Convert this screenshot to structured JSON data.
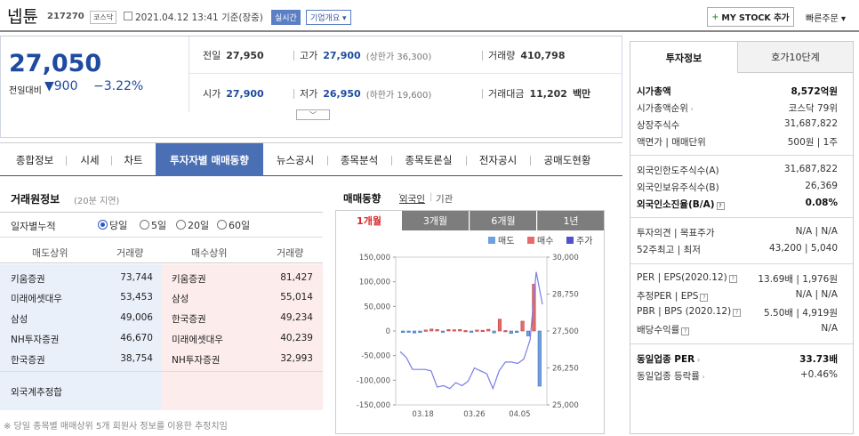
{
  "header": {
    "name": "넵튠",
    "code": "217270",
    "market": "코스닥",
    "datetime": "2021.04.12 13:41 기준(장중)",
    "live": "실시간",
    "company_btn": "기업개요 ▾",
    "mystock": "MY STOCK 추가",
    "quick_order": "빠른주문 ▾"
  },
  "price": {
    "current": "27,050",
    "change_label": "전일대비",
    "change": "▼900",
    "rate": "−3.22%"
  },
  "quote": {
    "prev_label": "전일",
    "prev": "27,950",
    "high_label": "고가",
    "high": "27,900",
    "upper": "(상한가 36,300)",
    "vol_label": "거래량",
    "vol": "410,798",
    "open_label": "시가",
    "open": "27,900",
    "low_label": "저가",
    "low": "26,950",
    "lower": "(하한가 19,600)",
    "amt_label": "거래대금",
    "amt": "11,202",
    "amt_unit": "백만"
  },
  "tabs": [
    "종합정보",
    "시세",
    "차트",
    "투자자별 매매동향",
    "뉴스공시",
    "종목분석",
    "종목토론실",
    "전자공시",
    "공매도현황"
  ],
  "broker": {
    "title": "거래원정보",
    "sub": "(20분 지연)",
    "period_label": "일자별누적",
    "options": [
      "당일",
      "5일",
      "20일",
      "60일"
    ],
    "headers": [
      "매도상위",
      "거래량",
      "매수상위",
      "거래량"
    ],
    "rows": [
      {
        "sell": "키움증권",
        "sell_vol": "73,744",
        "buy": "키움증권",
        "buy_vol": "81,427"
      },
      {
        "sell": "미래에셋대우",
        "sell_vol": "53,453",
        "buy": "삼성",
        "buy_vol": "55,014"
      },
      {
        "sell": "삼성",
        "sell_vol": "49,006",
        "buy": "한국증권",
        "buy_vol": "49,234"
      },
      {
        "sell": "NH투자증권",
        "sell_vol": "46,670",
        "buy": "미래에셋대우",
        "buy_vol": "40,239"
      },
      {
        "sell": "한국증권",
        "sell_vol": "38,754",
        "buy": "NH투자증권",
        "buy_vol": "32,993"
      }
    ],
    "foreign": "외국계추정합",
    "note": "※ 당일 종목별 매매상위 5개 회원사 정보를 이용한 추정치임"
  },
  "trade_chart": {
    "title": "매매동향",
    "foreign": "외국인",
    "inst": "기관",
    "periods": [
      "1개월",
      "3개월",
      "6개월",
      "1년"
    ]
  },
  "chart_data": {
    "type": "bar",
    "legend": [
      "매도",
      "매수",
      "주가"
    ],
    "x_ticks": [
      "03.18",
      "03.26",
      "04.05"
    ],
    "y_left_ticks": [
      "150,000",
      "100,000",
      "50,000",
      "0",
      "-50,000",
      "-100,000",
      "-150,000"
    ],
    "y_right_ticks": [
      "30,000",
      "28,750",
      "27,500",
      "26,250",
      "25,000"
    ],
    "ylim_left": [
      -150000,
      150000
    ],
    "ylim_right": [
      25000,
      30000
    ],
    "net": [
      -3000,
      -2000,
      -4000,
      -3000,
      2000,
      4000,
      3000,
      -2000,
      3000,
      2500,
      3000,
      1000,
      -1000,
      2000,
      1500,
      3500,
      -4000,
      24000,
      1000,
      -5000,
      -3000,
      20000,
      -10000,
      95000,
      -112000
    ],
    "price": [
      26800,
      26600,
      26200,
      26200,
      26200,
      26150,
      25600,
      25650,
      25550,
      25750,
      25650,
      25800,
      26250,
      26150,
      26050,
      25550,
      26150,
      26450,
      26450,
      26400,
      26550,
      27200,
      29500,
      28400
    ]
  },
  "invest": {
    "tabs": [
      "투자정보",
      "호가10단계"
    ],
    "rows": [
      {
        "label": "시가총액",
        "value": "8,572억원"
      },
      {
        "label": "시가총액순위",
        "value": "코스닥 79위"
      },
      {
        "label": "상장주식수",
        "value": "31,687,822"
      },
      {
        "label": "액면가 | 매매단위",
        "value": "500원 | 1주"
      },
      {
        "label": "외국인한도주식수(A)",
        "value": "31,687,822"
      },
      {
        "label": "외국인보유주식수(B)",
        "value": "26,369"
      },
      {
        "label": "외국인소진율(B/A)",
        "value": "0.08%"
      },
      {
        "label": "투자의견 | 목표주가",
        "value": "N/A | N/A"
      },
      {
        "label": "52주최고 | 최저",
        "value": "43,200 | 5,040"
      },
      {
        "label": "PER | EPS(2020.12)",
        "value": "13.69배 | 1,976원"
      },
      {
        "label": "추정PER | EPS",
        "value": "N/A | N/A"
      },
      {
        "label": "PBR | BPS (2020.12)",
        "value": "5.50배 | 4,919원"
      },
      {
        "label": "배당수익률",
        "value": "N/A"
      },
      {
        "label": "동일업종 PER",
        "value": "33.73배"
      },
      {
        "label": "동일업종 등락률",
        "value": "+0.46%"
      }
    ]
  },
  "colors": {
    "up": "#d72b2b",
    "down": "#1e4aa0",
    "tab_active": "#4a6fb5",
    "sell_bar": "#6fa0e0",
    "buy_bar": "#e86a6a",
    "price_line": "#7b7be8"
  }
}
